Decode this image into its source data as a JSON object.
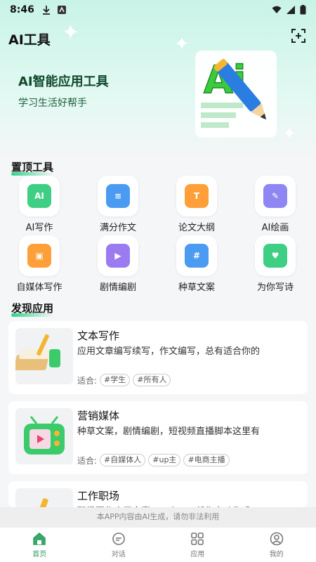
{
  "status_bar": {
    "time": "8:46"
  },
  "header": {
    "title": "AI工具"
  },
  "hero": {
    "title": "AI智能应用工具",
    "subtitle": "学习生活好帮手",
    "art_text": "Ai"
  },
  "pinned": {
    "title": "置顶工具",
    "tools": [
      {
        "label": "AI写作",
        "icon": "ai-write-icon",
        "color": "#3fcf84",
        "glyph": "AI"
      },
      {
        "label": "满分作文",
        "icon": "book-icon",
        "color": "#4c9bf2",
        "glyph": "≡"
      },
      {
        "label": "论文大纲",
        "icon": "outline-icon",
        "color": "#ff9f3a",
        "glyph": "T"
      },
      {
        "label": "AI绘画",
        "icon": "paint-icon",
        "color": "#8d86f3",
        "glyph": "✎"
      },
      {
        "label": "自媒体写作",
        "icon": "media-icon",
        "color": "#ff9f3a",
        "glyph": "▣"
      },
      {
        "label": "剧情编剧",
        "icon": "video-icon",
        "color": "#9b7cf0",
        "glyph": "▶"
      },
      {
        "label": "种草文案",
        "icon": "hashtag-icon",
        "color": "#4c9bf2",
        "glyph": "#"
      },
      {
        "label": "为你写诗",
        "icon": "poem-icon",
        "color": "#3fcf84",
        "glyph": "♥"
      }
    ]
  },
  "discover": {
    "title": "发现应用",
    "tag_prefix": "适合:",
    "apps": [
      {
        "title": "文本写作",
        "desc": "应用文章编写续写，作文编写，总有适合你的",
        "tags": [
          "#学生",
          "#所有人"
        ]
      },
      {
        "title": "营销媒体",
        "desc": "种草文案，剧情编剧，短视频直播脚本这里有",
        "tags": [
          "#自媒体人",
          "#up主",
          "#电商主播"
        ]
      },
      {
        "title": "工作职场",
        "desc": "职场写作应用文案不可少，AI帮你自动生成",
        "tags": []
      }
    ]
  },
  "notice": "本APP内容由AI生成，请勿非法利用",
  "tabbar": {
    "tabs": [
      {
        "label": "首页",
        "icon": "home-icon"
      },
      {
        "label": "对话",
        "icon": "chat-icon"
      },
      {
        "label": "应用",
        "icon": "apps-icon"
      },
      {
        "label": "我的",
        "icon": "profile-icon"
      }
    ]
  }
}
